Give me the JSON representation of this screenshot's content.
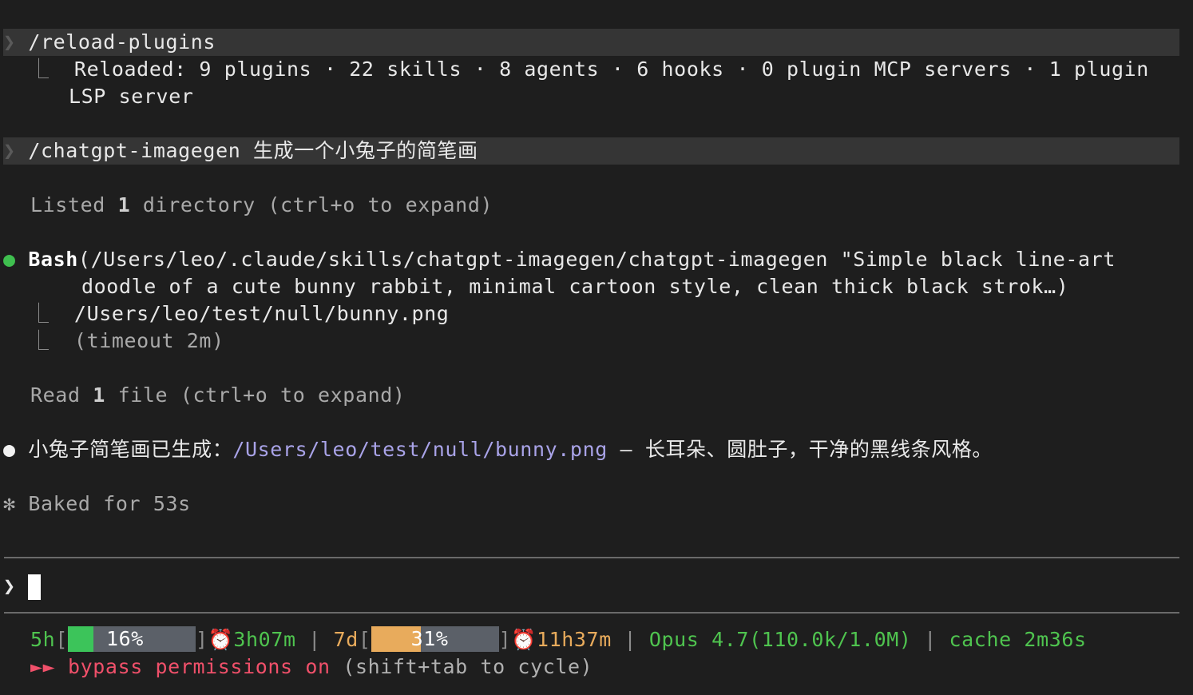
{
  "transcript": {
    "cmd1": {
      "prompt_symbol": "❯",
      "text": "/reload-plugins",
      "result_prefix": "⎿",
      "result_line1": "Reloaded: 9 plugins · 22 skills · 8 agents · 6 hooks · 0 plugin MCP servers · 1 plugin",
      "result_line2": "LSP server"
    },
    "cmd2": {
      "prompt_symbol": "❯",
      "text": "/chatgpt-imagegen 生成一个小兔子的简笔画"
    },
    "listed": {
      "word": "Listed",
      "count": "1",
      "rest": "directory (ctrl+o to expand)"
    },
    "bash": {
      "bullet": "●",
      "tool": "Bash",
      "args_line1": "(/Users/leo/.claude/skills/chatgpt-imagegen/chatgpt-imagegen \"Simple black line-art",
      "args_line2": "doodle of a cute bunny rabbit, minimal cartoon style, clean thick black strok…)",
      "result_prefix": "⎿",
      "output1": "/Users/leo/test/null/bunny.png",
      "output2": "(timeout 2m)"
    },
    "read": {
      "word": "Read",
      "count": "1",
      "rest": "file (ctrl+o to expand)"
    },
    "reply": {
      "bullet": "●",
      "before": "小兔子简笔画已生成：",
      "link": "/Users/leo/test/null/bunny.png",
      "after": " — 长耳朵、圆肚子，干净的黑线条风格。"
    },
    "status": {
      "symbol": "✻",
      "text": "Baked for 53s"
    }
  },
  "input": {
    "prompt_symbol": "❯",
    "value": ""
  },
  "statusline": {
    "five_hour": {
      "label": "5h",
      "percent_text": "16%",
      "percent": 0.16,
      "color": "#3cc45a",
      "reset": "3h07m"
    },
    "seven_day": {
      "label": "7d",
      "percent_text": "31%",
      "percent": 0.31,
      "color": "#e8ab5c",
      "reset": "11h37m"
    },
    "clock_icon": "⏰",
    "model": "Opus 4.7",
    "context": "(110.0k/1.0M)",
    "cache_label": "cache",
    "cache_value": "2m36s",
    "separator": "|"
  },
  "mode": {
    "arrows": "►►",
    "label": "bypass permissions on",
    "hint": "(shift+tab to cycle)"
  },
  "colors": {
    "background": "#1e1e1e",
    "highlight_row": "#353535",
    "green": "#4fc44f",
    "link": "#a9a3e8",
    "mode_red": "#f0506a"
  }
}
